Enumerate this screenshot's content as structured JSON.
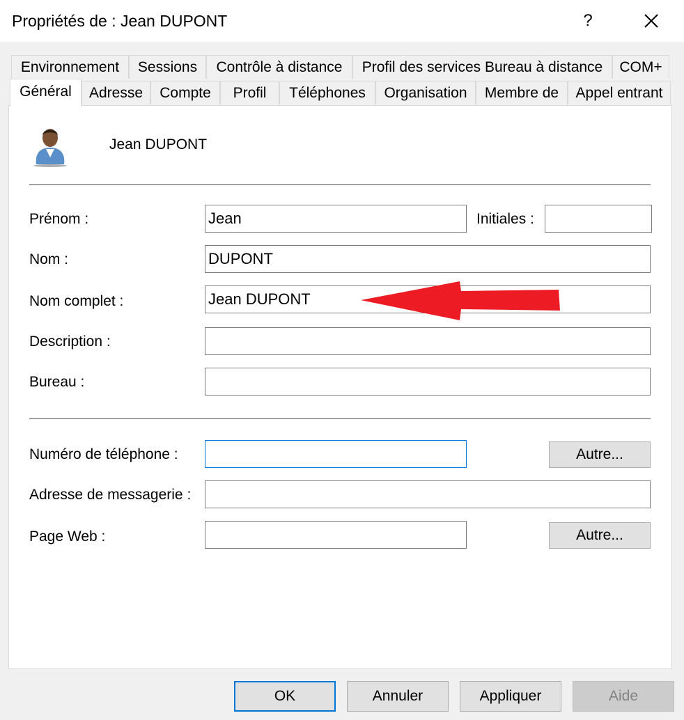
{
  "window": {
    "title": "Propriétés de : Jean DUPONT",
    "help_label": "?",
    "close_icon": "close-icon"
  },
  "tabs_row1": [
    {
      "label": "Environnement"
    },
    {
      "label": "Sessions"
    },
    {
      "label": "Contrôle à distance"
    },
    {
      "label": "Profil des services Bureau à distance"
    },
    {
      "label": "COM+"
    }
  ],
  "tabs_row2": [
    {
      "label": "Général",
      "active": true
    },
    {
      "label": "Adresse"
    },
    {
      "label": "Compte"
    },
    {
      "label": "Profil"
    },
    {
      "label": "Téléphones"
    },
    {
      "label": "Organisation"
    },
    {
      "label": "Membre de"
    },
    {
      "label": "Appel entrant"
    }
  ],
  "header": {
    "display_name": "Jean DUPONT",
    "avatar_icon": "user-avatar-icon"
  },
  "form": {
    "prenom_label": "Prénom :",
    "prenom_value": "Jean",
    "initiales_label": "Initiales :",
    "initiales_value": "",
    "nom_label": "Nom :",
    "nom_value": "DUPONT",
    "nom_complet_label": "Nom complet :",
    "nom_complet_value": "Jean DUPONT",
    "description_label": "Description :",
    "description_value": "",
    "bureau_label": "Bureau :",
    "bureau_value": "",
    "telephone_label": "Numéro de téléphone :",
    "telephone_value": "",
    "autre_label": "Autre...",
    "email_label": "Adresse de messagerie :",
    "email_value": "",
    "web_label": "Page Web :",
    "web_value": "",
    "autre_web_label": "Autre..."
  },
  "annotation": {
    "arrow_color": "#ed1c24"
  },
  "buttons": {
    "ok": "OK",
    "cancel": "Annuler",
    "apply": "Appliquer",
    "help": "Aide"
  }
}
